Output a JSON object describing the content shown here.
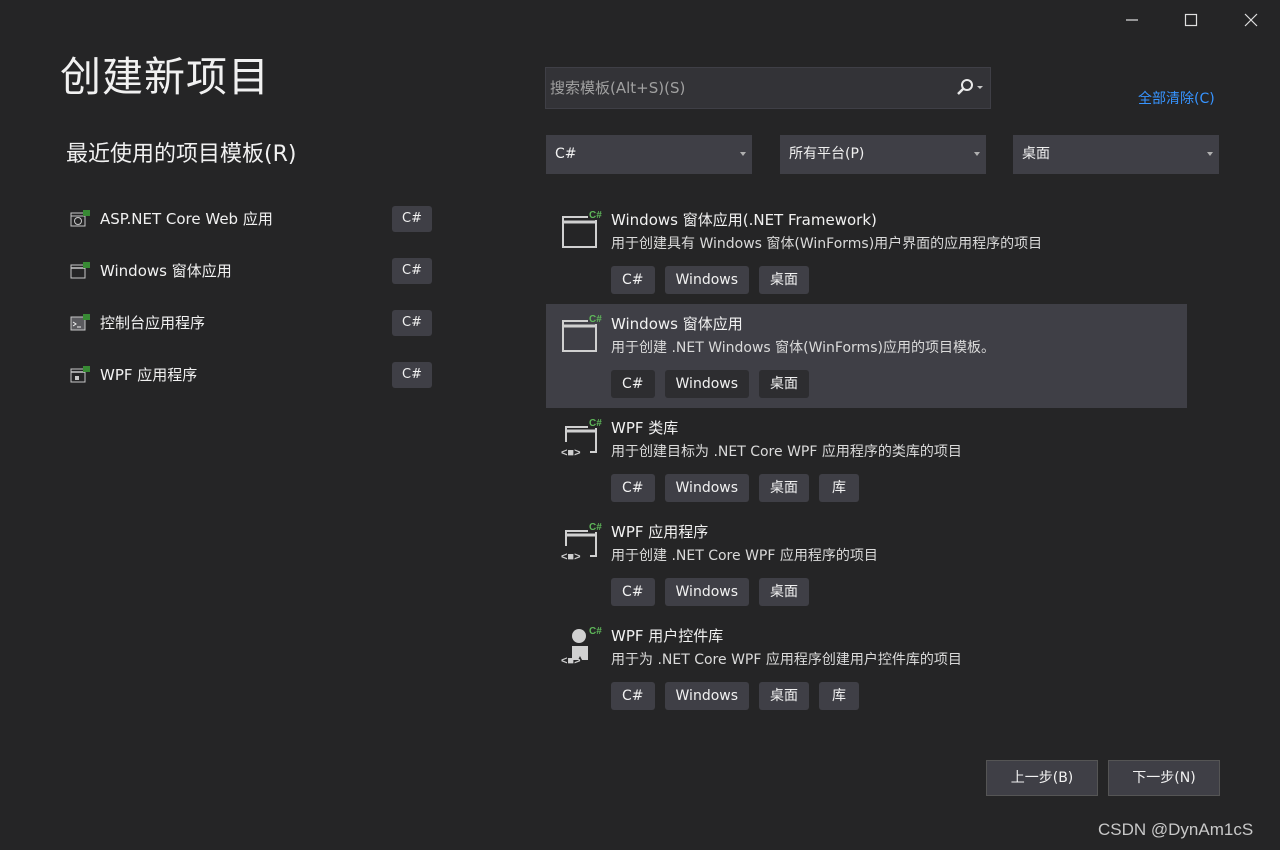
{
  "window": {
    "controls": [
      {
        "name": "minimize",
        "icon": "minimize-icon"
      },
      {
        "name": "maximize",
        "icon": "maximize-icon"
      },
      {
        "name": "close",
        "icon": "close-icon"
      }
    ]
  },
  "page": {
    "title": "创建新项目",
    "recent_title": "最近使用的项目模板(R)"
  },
  "recent": [
    {
      "label": "ASP.NET Core Web 应用",
      "tag": "C#",
      "icon": "web-app-icon"
    },
    {
      "label": "Windows 窗体应用",
      "tag": "C#",
      "icon": "winforms-icon"
    },
    {
      "label": "控制台应用程序",
      "tag": "C#",
      "icon": "console-app-icon"
    },
    {
      "label": "WPF 应用程序",
      "tag": "C#",
      "icon": "wpf-app-icon"
    }
  ],
  "search": {
    "placeholder": "搜索模板(Alt+S)(S)",
    "value": "",
    "icon": "search-icon"
  },
  "clear_all": "全部清除(C)",
  "filters": {
    "language": "C#",
    "platform": "所有平台(P)",
    "project_type": "桌面"
  },
  "templates": [
    {
      "name": "Windows 窗体应用(.NET Framework)",
      "desc": "用于创建具有 Windows 窗体(WinForms)用户界面的应用程序的项目",
      "tags": [
        "C#",
        "Windows",
        "桌面"
      ],
      "selected": false,
      "icon": "winforms-icon"
    },
    {
      "name": "Windows 窗体应用",
      "desc": "用于创建 .NET Windows 窗体(WinForms)应用的项目模板。",
      "tags": [
        "C#",
        "Windows",
        "桌面"
      ],
      "selected": true,
      "icon": "winforms-icon"
    },
    {
      "name": "WPF 类库",
      "desc": "用于创建目标为 .NET Core WPF 应用程序的类库的项目",
      "tags": [
        "C#",
        "Windows",
        "桌面",
        "库"
      ],
      "selected": false,
      "icon": "wpf-library-icon"
    },
    {
      "name": "WPF 应用程序",
      "desc": "用于创建 .NET Core WPF 应用程序的项目",
      "tags": [
        "C#",
        "Windows",
        "桌面"
      ],
      "selected": false,
      "icon": "wpf-app-icon"
    },
    {
      "name": "WPF 用户控件库",
      "desc": "用于为 .NET Core WPF 应用程序创建用户控件库的项目",
      "tags": [
        "C#",
        "Windows",
        "桌面",
        "库"
      ],
      "selected": false,
      "icon": "wpf-user-control-icon"
    }
  ],
  "buttons": {
    "back": "上一步(B)",
    "next": "下一步(N)"
  },
  "watermark": "CSDN @DynAm1cS",
  "colors": {
    "background": "#252526",
    "panel": "#3f3f46",
    "link": "#3794ff",
    "csharp_badge": "#388a34"
  }
}
